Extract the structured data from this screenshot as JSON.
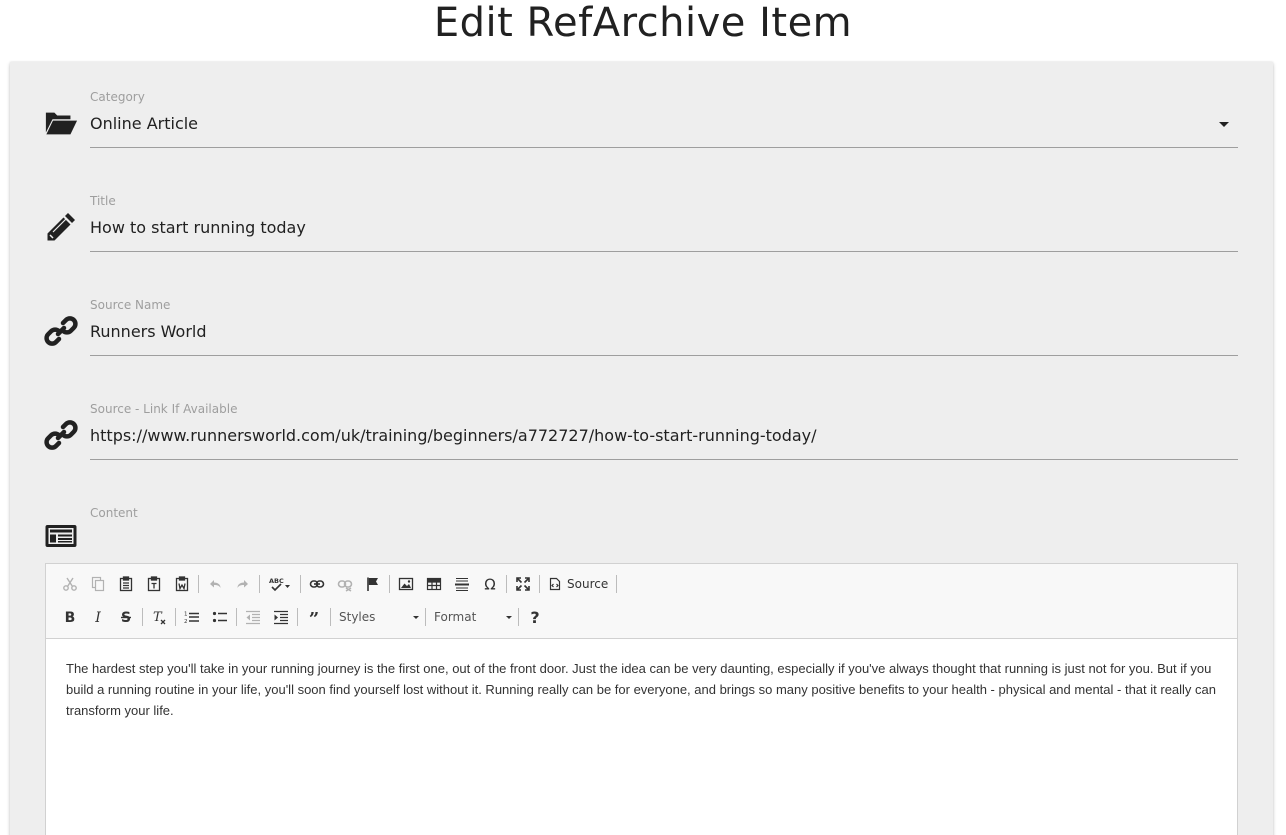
{
  "page_title": "Edit RefArchive Item",
  "fields": {
    "category": {
      "label": "Category",
      "value": "Online Article",
      "icon": "folder-open-icon"
    },
    "title": {
      "label": "Title",
      "value": "How to start running today",
      "icon": "pencil-icon"
    },
    "source_name": {
      "label": "Source Name",
      "value": "Runners World",
      "icon": "link-icon"
    },
    "source_link": {
      "label": "Source - Link If Available",
      "value": "https://www.runnersworld.com/uk/training/beginners/a772727/how-to-start-running-today/",
      "icon": "link-icon"
    },
    "content": {
      "label": "Content",
      "icon": "newspaper-icon"
    }
  },
  "editor": {
    "toolbar": {
      "source_label": "Source",
      "styles_label": "Styles",
      "format_label": "Format",
      "help_label": "?"
    },
    "body": "The hardest step you'll take in your running journey is the first one, out of the front door. Just the idea can be very daunting, especially if you've always thought that running is just not for you. But if you build a running routine in your life, you'll soon find yourself lost without it. Running really can be for everyone, and brings so many positive benefits to your health - physical and mental - that it really can transform your life."
  },
  "colors": {
    "card_background": "#eeeeee",
    "label": "#9e9e9e",
    "text": "#212121",
    "underline": "#9e9e9e"
  }
}
